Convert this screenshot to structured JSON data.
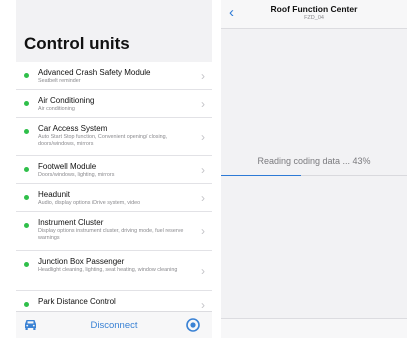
{
  "left": {
    "title": "Control units",
    "items": [
      {
        "name": "Advanced Crash Safety Module",
        "desc": "Seatbelt reminder"
      },
      {
        "name": "Air Conditioning",
        "desc": "Air conditioning"
      },
      {
        "name": "Car Access System",
        "desc": "Auto Start Stop function, Convenient opening/ closing, doors/windows, mirrors"
      },
      {
        "name": "Footwell Module",
        "desc": "Doors/windows, lighting, mirrors"
      },
      {
        "name": "Headunit",
        "desc": "Audio, display options iDrive system, video"
      },
      {
        "name": "Instrument Cluster",
        "desc": "Display options instrument cluster, driving mode, fuel reserve warnings"
      },
      {
        "name": "Junction Box Passenger",
        "desc": "Headlight cleaning, lighting, seat heating, window cleaning"
      },
      {
        "name": "Park Distance Control",
        "desc": ""
      }
    ],
    "status_color": "#2fbf4a",
    "tabbar": {
      "disconnect_label": "Disconnect",
      "car_icon": "car-icon",
      "settings_icon": "gear-icon"
    }
  },
  "right": {
    "nav_title": "Roof Function Center",
    "nav_subtitle": "FZD_04",
    "reading_text": "Reading coding data ... 43%",
    "progress": 0.43,
    "accent_color": "#2d7ad6"
  }
}
